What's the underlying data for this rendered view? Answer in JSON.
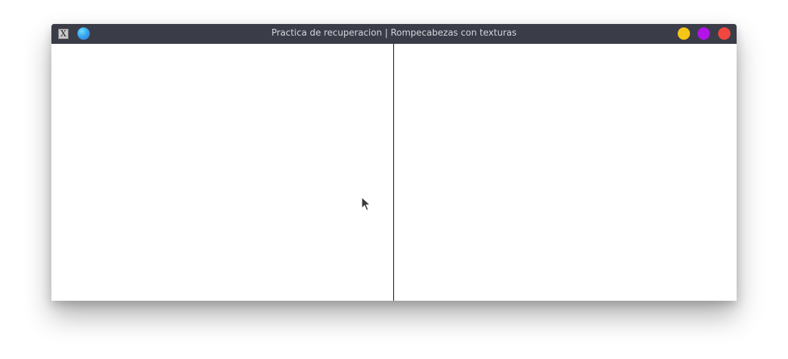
{
  "window": {
    "title": "Practica de recuperacion | Rompecabezas con texturas",
    "app_icon": "x11-app-icon",
    "app_icon_glyph": "X",
    "menu_icon": "sphere-menu-icon",
    "controls": [
      {
        "name": "minimize-button",
        "color": "#f5c518"
      },
      {
        "name": "maximize-button",
        "color": "#b213e8"
      },
      {
        "name": "close-button",
        "color": "#f2473f"
      }
    ],
    "titlebar_color": "#3a3c48"
  },
  "content": {
    "panes": [
      "left-viewport",
      "right-viewport"
    ],
    "background": "#ffffff",
    "divider_color": "#000000"
  },
  "cursor": {
    "icon": "mouse-pointer-icon"
  }
}
